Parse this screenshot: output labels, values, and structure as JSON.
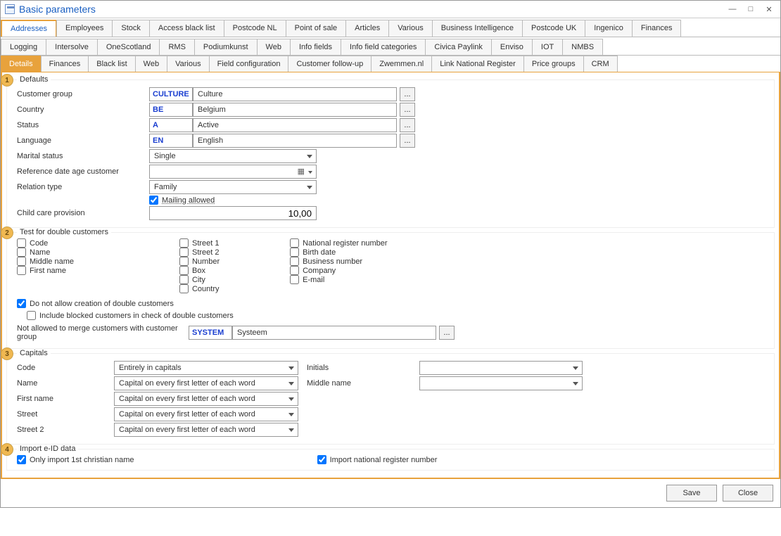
{
  "title": "Basic parameters",
  "win": {
    "min": "—",
    "max": "□",
    "close": "✕"
  },
  "tabs1": [
    "Addresses",
    "Employees",
    "Stock",
    "Access black list",
    "Postcode NL",
    "Point of sale",
    "Articles",
    "Various",
    "Business Intelligence",
    "Postcode UK",
    "Ingenico",
    "Finances"
  ],
  "tabs2": [
    "Logging",
    "Intersolve",
    "OneScotland",
    "RMS",
    "Podiumkunst",
    "Web",
    "Info fields",
    "Info field categories",
    "Civica Paylink",
    "Enviso",
    "IOT",
    "NMBS"
  ],
  "subtabs": [
    "Details",
    "Finances",
    "Black list",
    "Web",
    "Various",
    "Field configuration",
    "Customer follow-up",
    "Zwemmen.nl",
    "Link National Register",
    "Price groups",
    "CRM"
  ],
  "defaults": {
    "legend": "Defaults",
    "badge": "1",
    "custgroup_lbl": "Customer group",
    "custgroup_code": "CULTURE",
    "custgroup_text": "Culture",
    "country_lbl": "Country",
    "country_code": "BE",
    "country_text": "Belgium",
    "status_lbl": "Status",
    "status_code": "A",
    "status_text": "Active",
    "lang_lbl": "Language",
    "lang_code": "EN",
    "lang_text": "English",
    "marital_lbl": "Marital status",
    "marital_val": "Single",
    "refdate_lbl": "Reference date age customer",
    "reltype_lbl": "Relation type",
    "reltype_val": "Family",
    "mailing_lbl": "Mailing allowed",
    "care_lbl": "Child care provision",
    "care_val": "10,00"
  },
  "dbl": {
    "legend": "Test for double customers",
    "badge": "2",
    "col1": [
      "Code",
      "Name",
      "Middle name",
      "First name"
    ],
    "col2": [
      "Street 1",
      "Street 2",
      "Number",
      "Box",
      "City",
      "Country"
    ],
    "col3": [
      "National register number",
      "Birth date",
      "Business number",
      "Company",
      "E-mail"
    ],
    "noallow_lbl": "Do not allow creation of double customers",
    "include_lbl": "Include blocked customers in check of double customers",
    "merge_lbl": "Not allowed to merge customers with customer group",
    "merge_code": "SYSTEM",
    "merge_text": "Systeem"
  },
  "caps": {
    "legend": "Capitals",
    "badge": "3",
    "code_lbl": "Code",
    "code_val": "Entirely in capitals",
    "name_lbl": "Name",
    "name_val": "Capital on every first letter of each word",
    "fname_lbl": "First name",
    "fname_val": "Capital on every first letter of each word",
    "street_lbl": "Street",
    "street_val": "Capital on every first letter of each word",
    "street2_lbl": "Street 2",
    "street2_val": "Capital on every first letter of each word",
    "initials_lbl": "Initials",
    "middle_lbl": "Middle name"
  },
  "eid": {
    "legend": "Import e-ID data",
    "badge": "4",
    "only1st": "Only import 1st christian name",
    "impnat": "Import national register number"
  },
  "footer": {
    "save": "Save",
    "close": "Close"
  },
  "ell": "..."
}
